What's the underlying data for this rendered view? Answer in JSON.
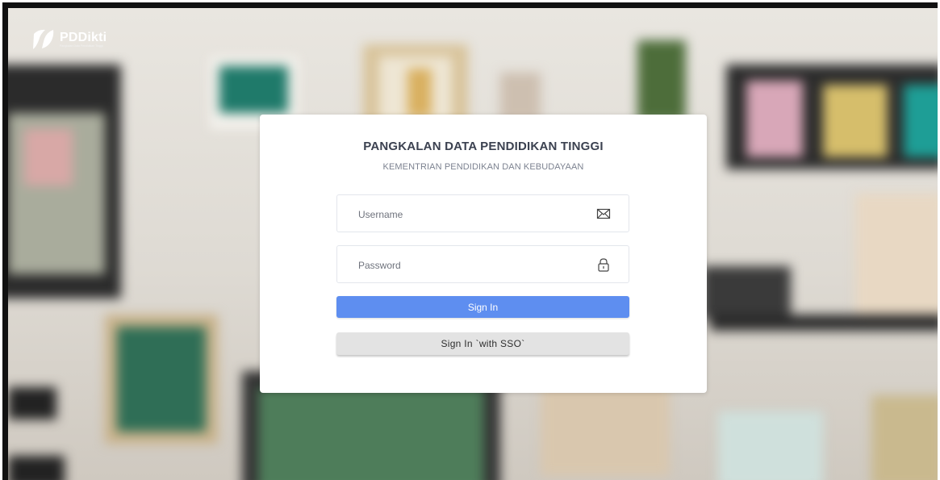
{
  "brand": {
    "name": "PDDikti",
    "tagline": "Pangkalan Data Pendidikan Tinggi"
  },
  "login": {
    "title": "PANGKALAN DATA PENDIDIKAN TINGGI",
    "subtitle": "KEMENTRIAN PENDIDIKAN DAN KEBUDAYAAN",
    "username": {
      "value": "",
      "placeholder": "Username",
      "icon": "envelope-icon"
    },
    "password": {
      "value": "",
      "placeholder": "Password",
      "icon": "lock-icon"
    },
    "sign_in_label": "Sign In",
    "sso_label": "Sign In `with SSO`"
  },
  "colors": {
    "primary_button": "#5e8ef0",
    "secondary_button": "#e3e3e3",
    "title_text": "#3b4150"
  }
}
